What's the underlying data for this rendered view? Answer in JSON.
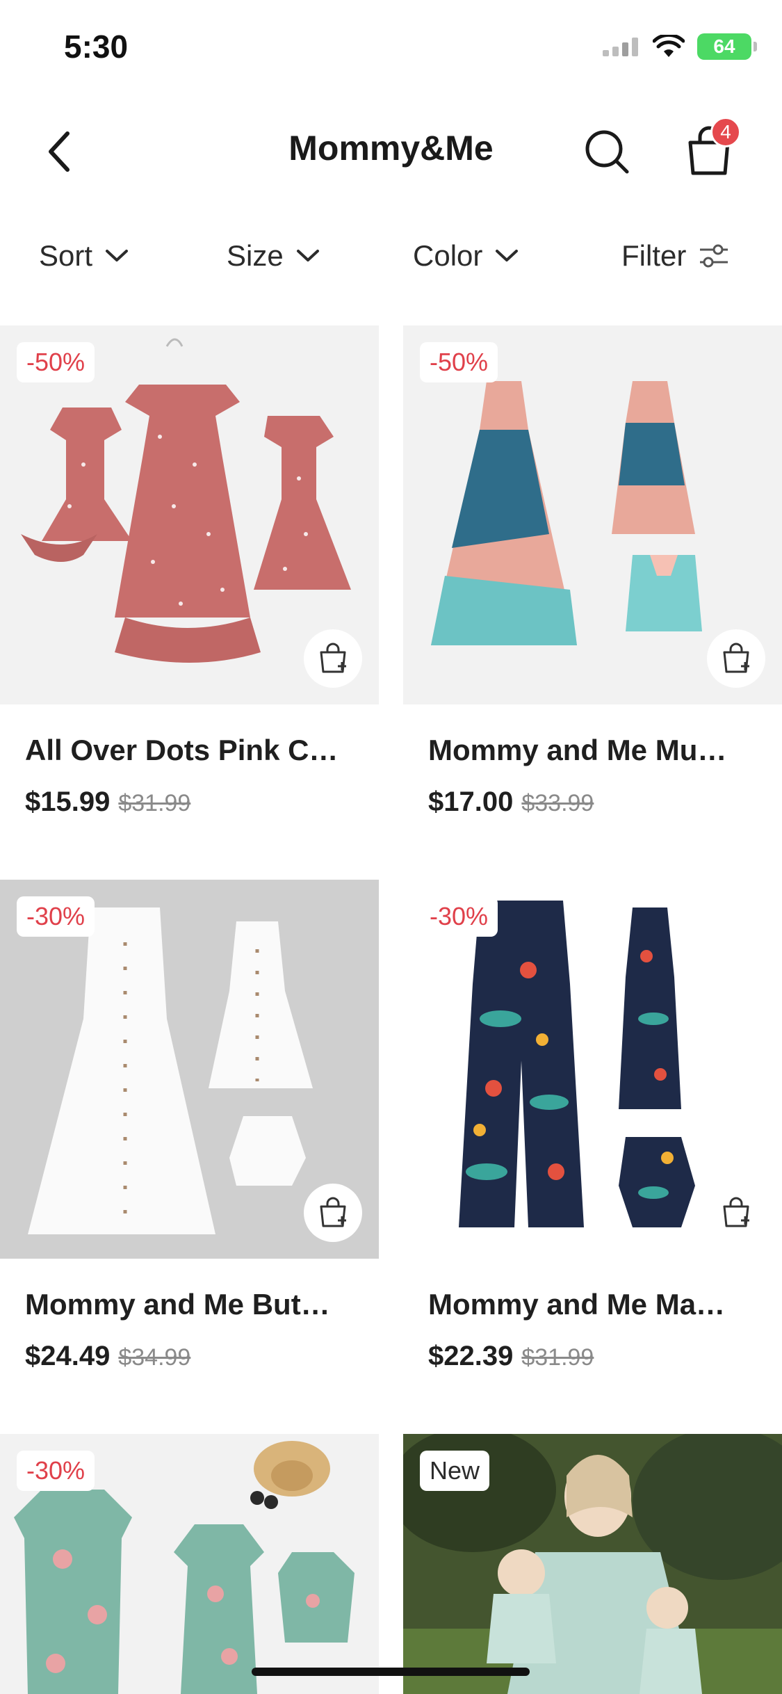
{
  "status_bar": {
    "time": "5:30",
    "battery": "64"
  },
  "header": {
    "title": "Mommy&Me",
    "cart_count": "4"
  },
  "filters": [
    {
      "label": "Sort"
    },
    {
      "label": "Size"
    },
    {
      "label": "Color"
    },
    {
      "label": "Filter"
    }
  ],
  "products": [
    {
      "tag": "-50%",
      "name": "All Over Dots Pink C…",
      "price": "$15.99",
      "old_price": "$31.99"
    },
    {
      "tag": "-50%",
      "name": "Mommy and Me Mu…",
      "price": "$17.00",
      "old_price": "$33.99"
    },
    {
      "tag": "-30%",
      "name": "Mommy and Me But…",
      "price": "$24.49",
      "old_price": "$34.99"
    },
    {
      "tag": "-30%",
      "name": "Mommy and Me Ma…",
      "price": "$22.39",
      "old_price": "$31.99"
    },
    {
      "tag": "-30%"
    },
    {
      "tag": "New"
    }
  ],
  "colors": {
    "accent_red": "#e0404a",
    "badge_red": "#e5484d",
    "battery_green": "#4cd964"
  }
}
